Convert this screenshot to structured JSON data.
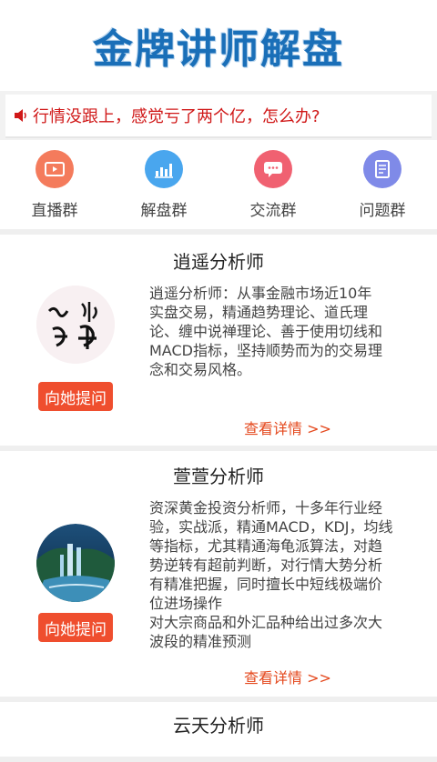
{
  "header": {
    "title": "金牌讲师解盘"
  },
  "notice": {
    "text": "行情没跟上，感觉亏了两个亿，怎么办?"
  },
  "nav": [
    {
      "label": "直播群",
      "icon": "tv-icon",
      "color": "#f47b5c"
    },
    {
      "label": "解盘群",
      "icon": "bar-chart-icon",
      "color": "#49a6ee"
    },
    {
      "label": "交流群",
      "icon": "chat-icon",
      "color": "#f06171"
    },
    {
      "label": "问题群",
      "icon": "document-icon",
      "color": "#7f8ae8"
    }
  ],
  "analysts": [
    {
      "name": "逍遥分析师",
      "avatar": "calligraphy-avatar",
      "ask_label": "向她提问",
      "desc": [
        "逍遥分析师：从事金融市场近10年",
        "实盘交易，精通趋势理论、道氏理",
        "论、缠中说禅理论、善于使用切线和",
        "MACD指标，坚持顺势而为的交易理",
        "念和交易风格。"
      ],
      "more_label": "查看详情 >>"
    },
    {
      "name": "萱萱分析师",
      "avatar": "waterfall-avatar",
      "ask_label": "向她提问",
      "desc": [
        "资深黄金投资分析师，十多年行业经",
        "验，实战派，精通MACD，KDJ，均线",
        "等指标，尤其精通海龟派算法，对趋",
        "势逆转有超前判断，对行情大势分析",
        "有精准把握，同时擅长中短线极端价",
        "位进场操作",
        "对大宗商品和外汇品种给出过多次大",
        "波段的精准预测"
      ],
      "more_label": "查看详情 >>"
    },
    {
      "name": "云天分析师"
    }
  ],
  "colors": {
    "accent_red": "#ef4e2e",
    "title_blue": "#1a6fb8",
    "notice_red": "#d01818"
  }
}
